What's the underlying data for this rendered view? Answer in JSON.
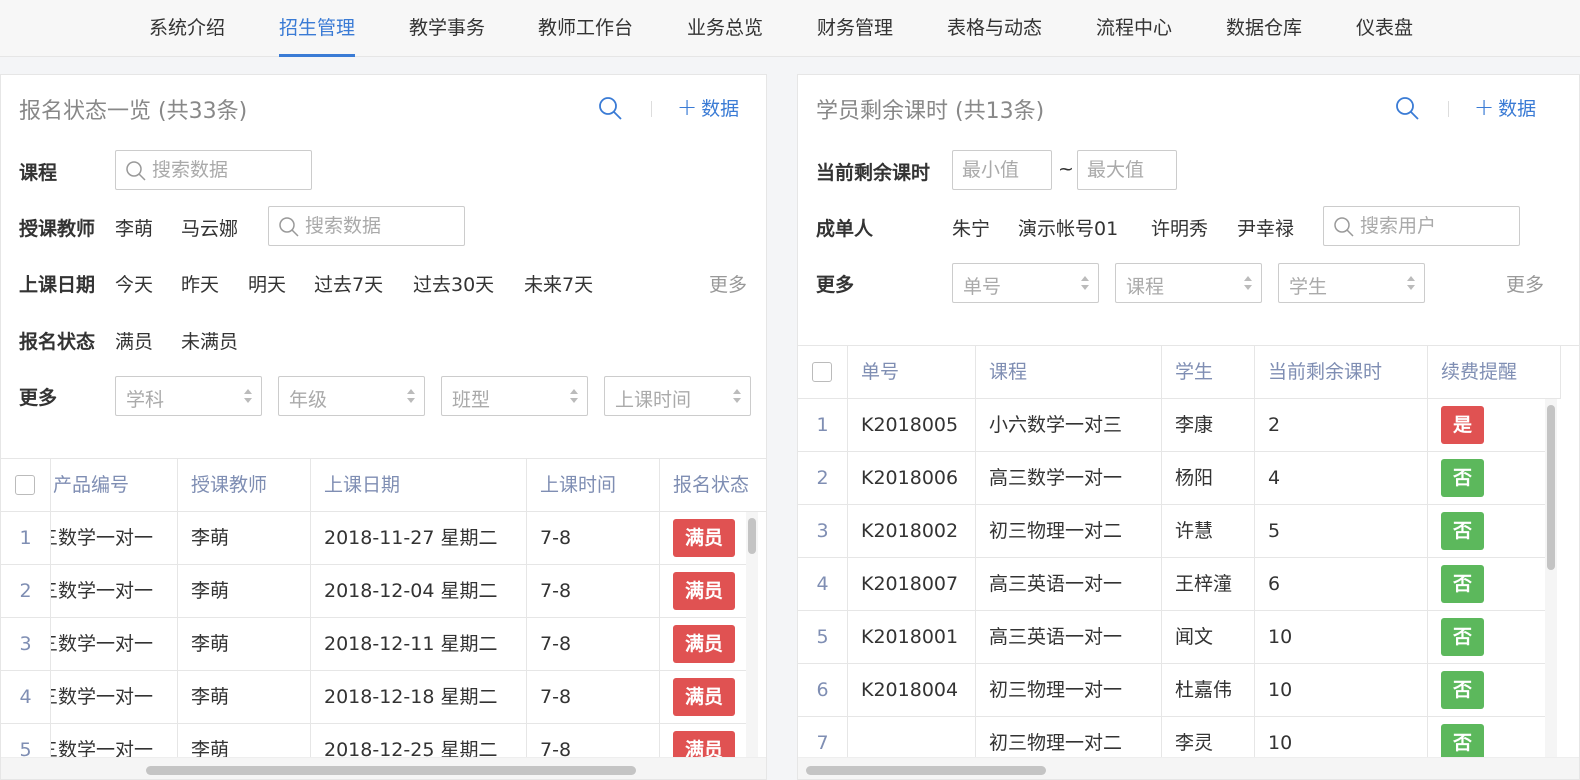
{
  "nav": {
    "tabs": [
      "系统介绍",
      "招生管理",
      "教学事务",
      "教师工作台",
      "业务总览",
      "财务管理",
      "表格与动态",
      "流程中心",
      "数据仓库",
      "仪表盘"
    ],
    "active_index": 1,
    "accent": "#3a7bd5"
  },
  "left": {
    "title": "报名状态一览 (共33条)",
    "add_label": "数据",
    "filters": {
      "course_label": "课程",
      "course_placeholder": "搜索数据",
      "teacher_label": "授课教师",
      "teacher_options": [
        "李萌",
        "马云娜"
      ],
      "teacher_placeholder": "搜索数据",
      "date_label": "上课日期",
      "date_options": [
        "今天",
        "昨天",
        "明天",
        "过去7天",
        "过去30天",
        "未来7天"
      ],
      "date_more": "更多",
      "status_label": "报名状态",
      "status_options": [
        "满员",
        "未满员"
      ],
      "more_label": "更多",
      "more_selects": [
        "学科",
        "年级",
        "班型",
        "上课时间"
      ]
    },
    "table": {
      "columns": [
        "产品编号",
        "授课教师",
        "上课日期",
        "上课时间",
        "报名状态"
      ],
      "rows": [
        {
          "idx": "1",
          "product": "三数学一对一",
          "teacher": "李萌",
          "date": "2018-11-27 星期二",
          "time": "7-8",
          "status": "满员"
        },
        {
          "idx": "2",
          "product": "三数学一对一",
          "teacher": "李萌",
          "date": "2018-12-04 星期二",
          "time": "7-8",
          "status": "满员"
        },
        {
          "idx": "3",
          "product": "三数学一对一",
          "teacher": "李萌",
          "date": "2018-12-11 星期二",
          "time": "7-8",
          "status": "满员"
        },
        {
          "idx": "4",
          "product": "三数学一对一",
          "teacher": "李萌",
          "date": "2018-12-18 星期二",
          "time": "7-8",
          "status": "满员"
        },
        {
          "idx": "5",
          "product": "三数学一对一",
          "teacher": "李萌",
          "date": "2018-12-25 星期二",
          "time": "7-8",
          "status": "满员"
        }
      ]
    }
  },
  "right": {
    "title": "学员剩余课时 (共13条)",
    "add_label": "数据",
    "filters": {
      "hours_label": "当前剩余课时",
      "min_placeholder": "最小值",
      "tilde": "~",
      "max_placeholder": "最大值",
      "owner_label": "成单人",
      "owner_options": [
        "朱宁",
        "演示帐号01",
        "许明秀",
        "尹幸禄"
      ],
      "owner_placeholder": "搜索用户",
      "more_label": "更多",
      "more_selects": [
        "单号",
        "课程",
        "学生"
      ],
      "more_link": "更多"
    },
    "table": {
      "columns": [
        "单号",
        "课程",
        "学生",
        "当前剩余课时",
        "续费提醒"
      ],
      "rows": [
        {
          "idx": "1",
          "no": "K2018005",
          "course": "小六数学一对三",
          "student": "李康",
          "hours": "2",
          "remind": "是"
        },
        {
          "idx": "2",
          "no": "K2018006",
          "course": "高三数学一对一",
          "student": "杨阳",
          "hours": "4",
          "remind": "否"
        },
        {
          "idx": "3",
          "no": "K2018002",
          "course": "初三物理一对二",
          "student": "许慧",
          "hours": "5",
          "remind": "否"
        },
        {
          "idx": "4",
          "no": "K2018007",
          "course": "高三英语一对一",
          "student": "王梓潼",
          "hours": "6",
          "remind": "否"
        },
        {
          "idx": "5",
          "no": "K2018001",
          "course": "高三英语一对一",
          "student": "闻文",
          "hours": "10",
          "remind": "否"
        },
        {
          "idx": "6",
          "no": "K2018004",
          "course": "初三物理一对一",
          "student": "杜嘉伟",
          "hours": "10",
          "remind": "否"
        },
        {
          "idx": "7",
          "no": "",
          "course": "初三物理一对二",
          "student": "李灵",
          "hours": "10",
          "remind": "否"
        }
      ]
    }
  },
  "colors": {
    "full_badge": "#e05252",
    "yes_badge": "#e05252",
    "no_badge": "#5cb85c",
    "header_text": "#7f8eb3"
  }
}
